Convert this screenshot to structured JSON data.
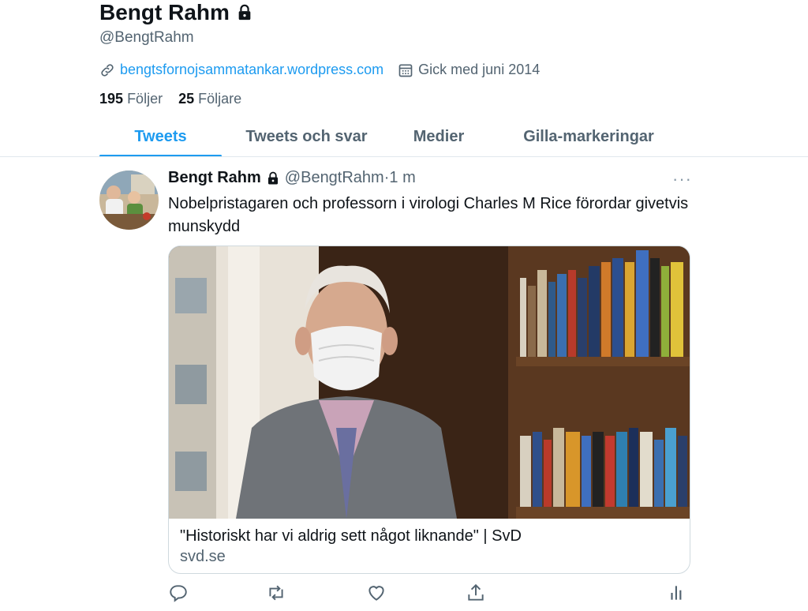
{
  "profile": {
    "name": "Bengt Rahm",
    "handle": "@BengtRahm",
    "website": "bengtsfornojsammatankar.wordpress.com",
    "joined": "Gick med juni 2014",
    "following_count": "195",
    "following_label": "Följer",
    "followers_count": "25",
    "followers_label": "Följare"
  },
  "tabs": [
    {
      "label": "Tweets",
      "active": true
    },
    {
      "label": "Tweets och svar",
      "active": false
    },
    {
      "label": "Medier",
      "active": false
    },
    {
      "label": "Gilla-markeringar",
      "active": false
    }
  ],
  "tweet": {
    "author": "Bengt Rahm",
    "handle": "@BengtRahm",
    "separator": "·",
    "time": "1 m",
    "more": "···",
    "text": "Nobelpristagaren och professorn i virologi Charles M Rice förordar givetvis munskydd",
    "card": {
      "title": "\"Historiskt har vi aldrig sett något liknande\" | SvD",
      "domain": "svd.se"
    }
  },
  "icons": {
    "lock": "lock-icon",
    "link": "link-icon",
    "calendar": "calendar-icon",
    "reply": "reply-icon",
    "retweet": "retweet-icon",
    "like": "heart-icon",
    "share": "share-icon",
    "analytics": "analytics-icon"
  },
  "colors": {
    "accent": "#1d9bf0",
    "secondary_text": "#536471",
    "primary_text": "#0f1419"
  }
}
